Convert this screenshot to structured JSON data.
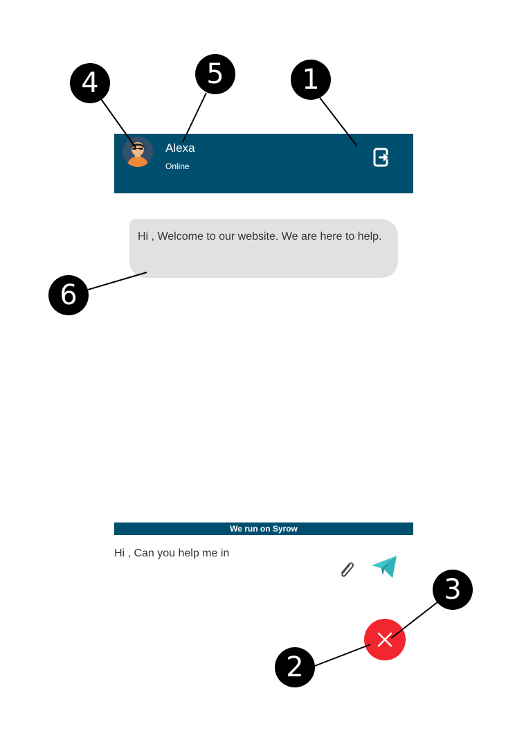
{
  "header": {
    "agent_name": "Alexa",
    "agent_status": "Online",
    "avatar_icon": "agent-avatar-icon",
    "exit_icon": "exit-chat-icon",
    "background_color": "#004f6e"
  },
  "messages": [
    {
      "sender": "agent",
      "text": "Hi , Welcome to our website. We are here to help."
    }
  ],
  "branding": {
    "text": "We run on Syrow"
  },
  "composer": {
    "input_value": "Hi , Can you help me in",
    "attach_icon": "paperclip-icon",
    "send_icon": "paper-plane-icon"
  },
  "launcher": {
    "close_icon": "close-icon",
    "color": "#f2262f"
  },
  "callouts": [
    "1",
    "2",
    "3",
    "4",
    "5",
    "6"
  ]
}
